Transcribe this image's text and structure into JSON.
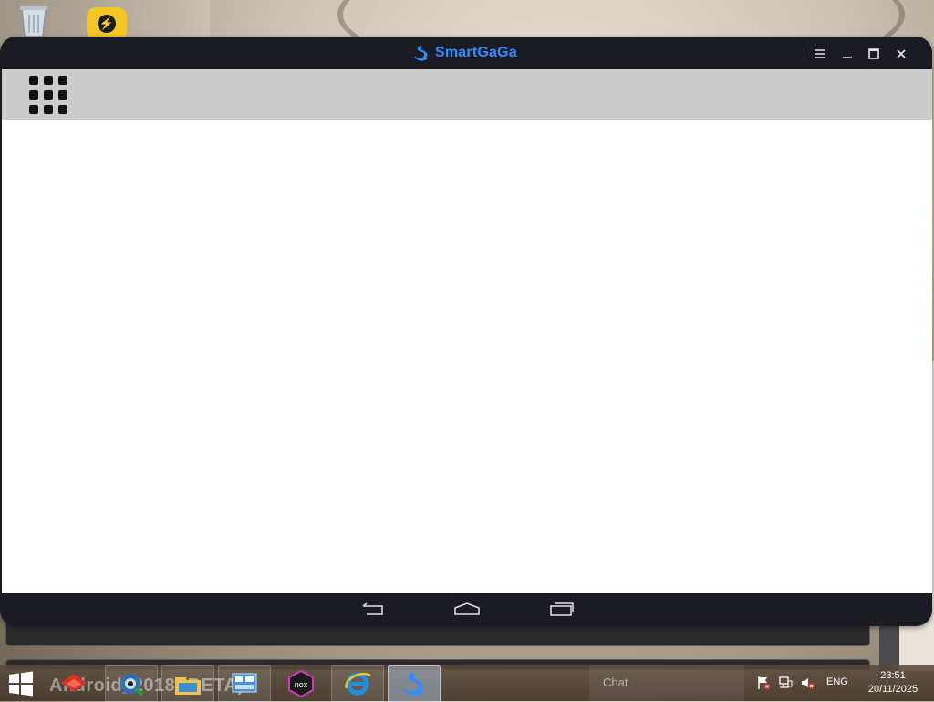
{
  "desktop": {
    "icons": [
      {
        "name": "recycle-bin-icon"
      },
      {
        "name": "bolt-app-icon"
      }
    ]
  },
  "emulator": {
    "brand": "SmartGaGa",
    "brand_color": "#2f8fff",
    "titlebar_controls": [
      "menu-icon",
      "minimize-icon",
      "maximize-icon",
      "close-icon"
    ],
    "toolbar_icon": "app-grid-icon",
    "nav_buttons": [
      "back-icon",
      "home-icon",
      "recent-apps-icon"
    ]
  },
  "taskbar": {
    "ghost_label": "Android_2018 (BETA)",
    "apps": [
      "red-app-icon",
      "camera-app-icon",
      "file-explorer-icon",
      "control-panel-icon",
      "nox-icon",
      "internet-explorer-icon",
      "smartgaga-icon"
    ],
    "chat_label": "Chat",
    "language": "ENG",
    "time": "23:51",
    "date": "20/11/2025"
  }
}
